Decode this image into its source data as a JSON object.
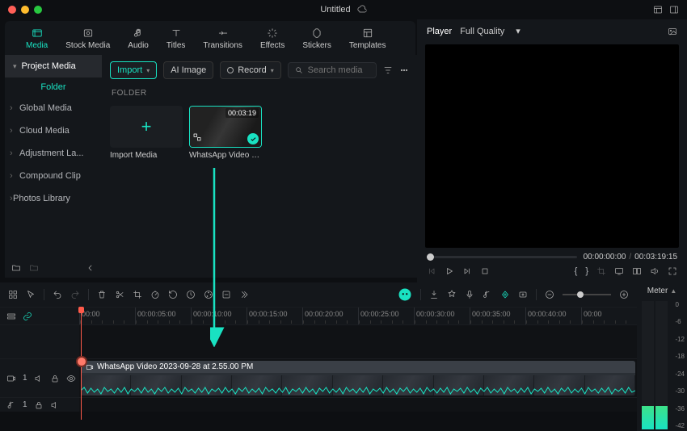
{
  "title": "Untitled",
  "nav": [
    "Media",
    "Stock Media",
    "Audio",
    "Titles",
    "Transitions",
    "Effects",
    "Stickers",
    "Templates"
  ],
  "sidebar": {
    "head": "Project Media",
    "folder": "Folder",
    "items": [
      "Global Media",
      "Cloud Media",
      "Adjustment La...",
      "Compound Clip",
      "Photos Library"
    ]
  },
  "toolbar": {
    "import": "Import",
    "ai": "AI Image",
    "record": "Record"
  },
  "search": {
    "placeholder": "Search media"
  },
  "folder_hdr": "FOLDER",
  "thumbs": {
    "import": "Import Media",
    "clip_name": "WhatsApp Video 202...",
    "clip_dur": "00:03:19"
  },
  "player": {
    "label": "Player",
    "quality": "Full Quality",
    "time_cur": "00:00:00:00",
    "time_total": "00:03:19:15"
  },
  "ruler": [
    "00:00",
    "00:00:05:00",
    "00:00:10:00",
    "00:00:15:00",
    "00:00:20:00",
    "00:00:25:00",
    "00:00:30:00",
    "00:00:35:00",
    "00:00:40:00",
    "00:00"
  ],
  "clip": {
    "name": "WhatsApp Video 2023-09-28 at 2.55.00 PM"
  },
  "tracks": {
    "v": "1",
    "a": "1"
  },
  "meter": {
    "label": "Meter",
    "scale": [
      "0",
      "-6",
      "-12",
      "-18",
      "-24",
      "-30",
      "-36",
      "-42"
    ]
  }
}
